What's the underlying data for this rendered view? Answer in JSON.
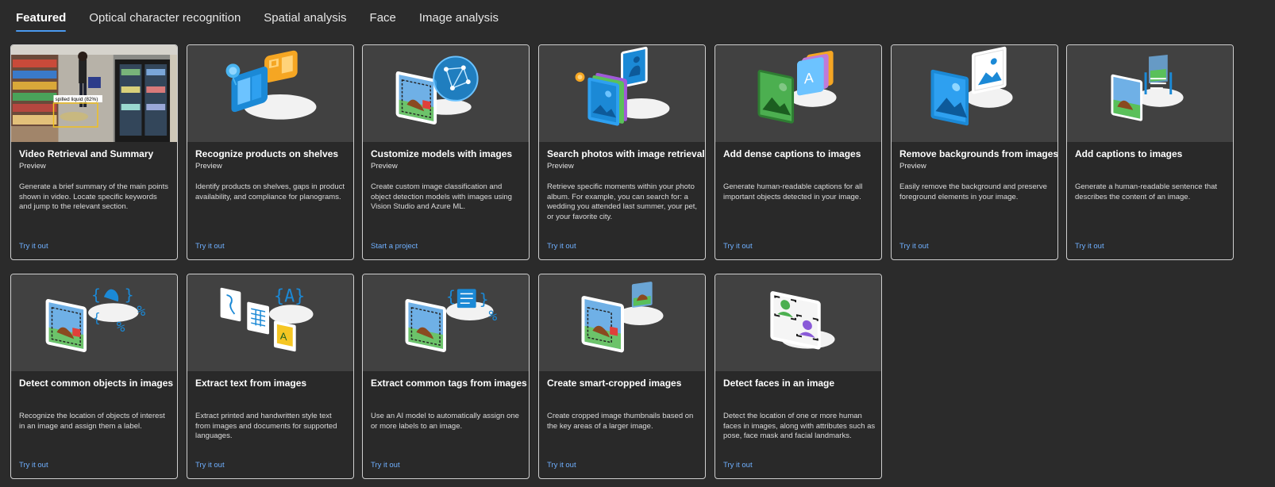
{
  "tabs": [
    {
      "label": "Featured"
    },
    {
      "label": "Optical character recognition"
    },
    {
      "label": "Spatial analysis"
    },
    {
      "label": "Face"
    },
    {
      "label": "Image analysis"
    }
  ],
  "cards": [
    {
      "title": "Video Retrieval and Summary",
      "badge": "Preview",
      "description": "Generate a brief summary of the main points shown in video. Locate specific keywords and jump to the relevant section.",
      "link": "Try it out",
      "thumb_label": "spilled liquid (82%)",
      "icon": "store-video-thumbnail"
    },
    {
      "title": "Recognize products on shelves",
      "badge": "Preview",
      "description": "Identify products on shelves, gaps in product availability, and compliance for planograms.",
      "link": "Try it out",
      "icon": "product-shelf-icon"
    },
    {
      "title": "Customize models with images",
      "badge": "Preview",
      "description": "Create custom image classification and object detection models with images using Vision Studio and Azure ML.",
      "link": "Start a project",
      "icon": "custom-model-icon"
    },
    {
      "title": "Search photos with image retrieval",
      "badge": "Preview",
      "description": "Retrieve specific moments within your photo album. For example, you can search for: a wedding you attended last summer, your pet, or your favorite city.",
      "link": "Try it out",
      "icon": "photo-search-icon"
    },
    {
      "title": "Add dense captions to images",
      "badge": "",
      "description": "Generate human-readable captions for all important objects detected in your image.",
      "link": "Try it out",
      "icon": "dense-caption-icon"
    },
    {
      "title": "Remove backgrounds from images",
      "badge": "Preview",
      "description": "Easily remove the background and preserve foreground elements in your image.",
      "link": "Try it out",
      "icon": "background-removal-icon"
    },
    {
      "title": "Add captions to images",
      "badge": "",
      "description": "Generate a human-readable sentence that describes the content of an image.",
      "link": "Try it out",
      "icon": "caption-icon"
    },
    {
      "title": "Detect common objects in images",
      "badge": "",
      "description": "Recognize the location of objects of interest in an image and assign them a label.",
      "link": "Try it out",
      "icon": "object-detection-icon"
    },
    {
      "title": "Extract text from images",
      "badge": "",
      "description": "Extract printed and handwritten style text from images and documents for supported languages.",
      "link": "Try it out",
      "icon": "ocr-icon"
    },
    {
      "title": "Extract common tags from images",
      "badge": "",
      "description": "Use an AI model to automatically assign one or more labels to an image.",
      "link": "Try it out",
      "icon": "tagging-icon"
    },
    {
      "title": "Create smart-cropped images",
      "badge": "",
      "description": "Create cropped image thumbnails based on the key areas of a larger image.",
      "link": "Try it out",
      "icon": "smart-crop-icon"
    },
    {
      "title": "Detect faces in an image",
      "badge": "",
      "description": "Detect the location of one or more human faces in images, along with attributes such as pose, face mask and facial landmarks.",
      "link": "Try it out",
      "icon": "face-detection-icon"
    }
  ],
  "colors": {
    "background": "#2b2b2b",
    "card": "#292929",
    "thumb": "#414141",
    "link": "#6fb0ff",
    "accent": "#4a9af0"
  }
}
